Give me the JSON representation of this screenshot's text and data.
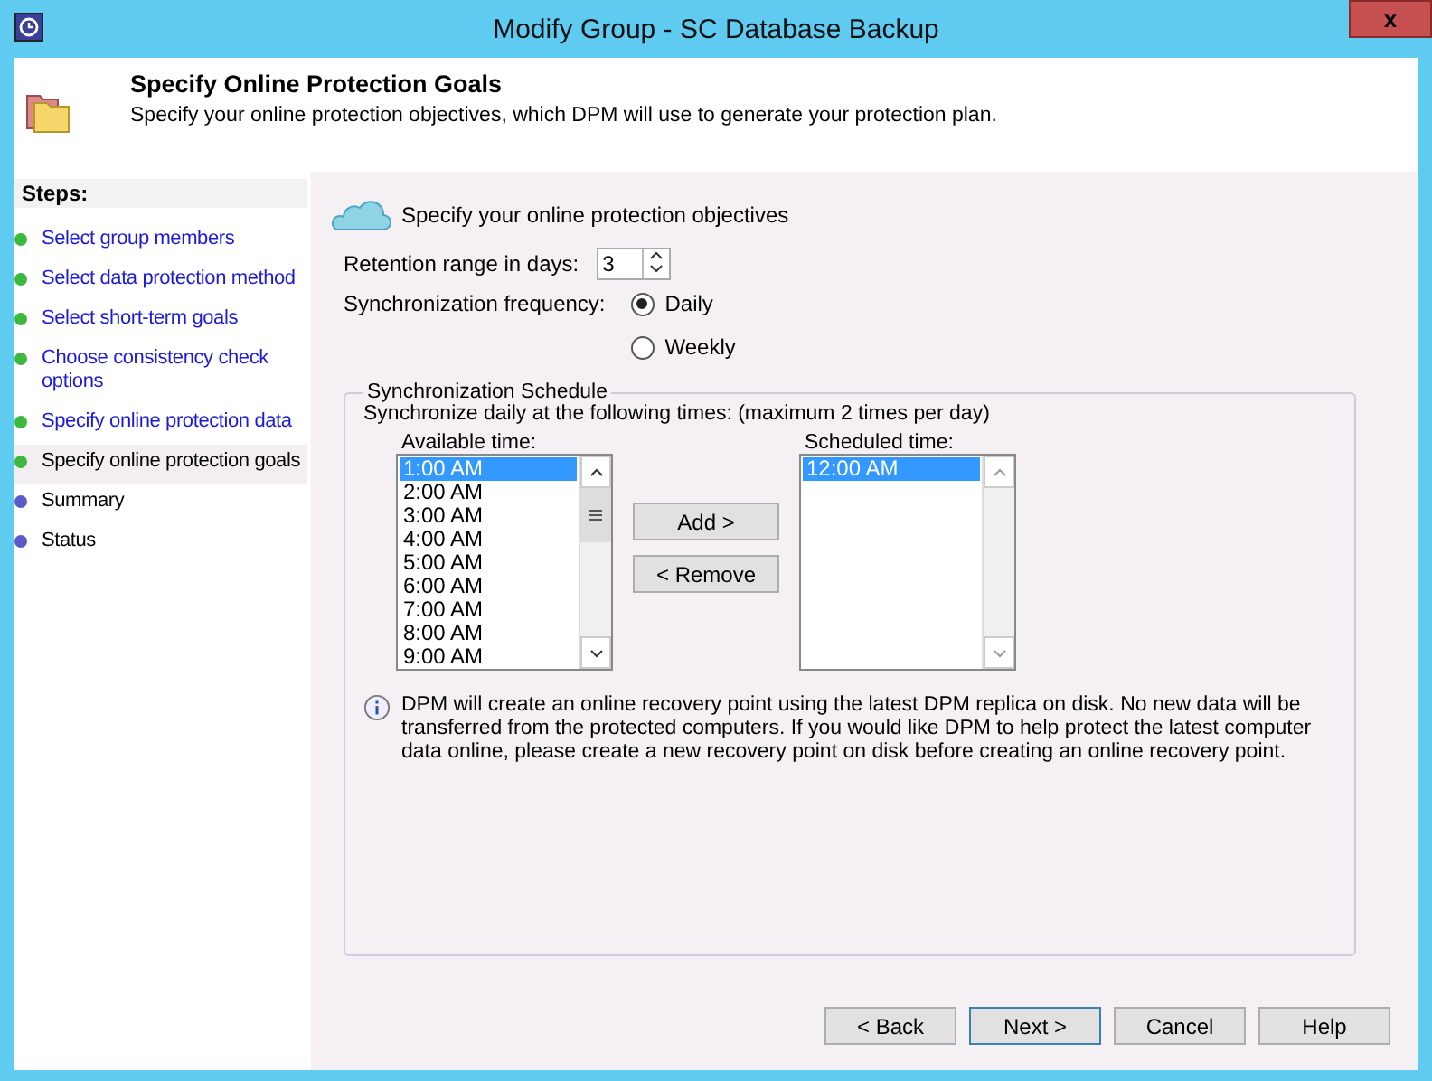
{
  "window": {
    "title": "Modify Group - SC Database Backup",
    "close": "x"
  },
  "header": {
    "title": "Specify Online Protection Goals",
    "subtitle": "Specify your online protection objectives, which DPM will use to generate your protection plan."
  },
  "sidebar": {
    "title": "Steps:",
    "items": [
      {
        "label": "Select group members",
        "kind": "link",
        "color": "#3cb93c",
        "selected": false
      },
      {
        "label": "Select data protection method",
        "kind": "link",
        "color": "#3cb93c",
        "selected": false
      },
      {
        "label": "Select short-term goals",
        "kind": "link",
        "color": "#3cb93c",
        "selected": false
      },
      {
        "label": "Choose consistency check options",
        "kind": "link",
        "color": "#3cb93c",
        "selected": false
      },
      {
        "label": "Specify online protection data",
        "kind": "link",
        "color": "#3cb93c",
        "selected": false
      },
      {
        "label": "Specify online protection goals",
        "kind": "plain",
        "color": "#3cb93c",
        "selected": true
      },
      {
        "label": "Summary",
        "kind": "plain",
        "color": "#5a5ac8",
        "selected": false
      },
      {
        "label": "Status",
        "kind": "plain",
        "color": "#5a5ac8",
        "selected": false
      }
    ]
  },
  "main": {
    "heading": "Specify your online protection objectives",
    "retention": {
      "label": "Retention range in days:",
      "value": "3"
    },
    "frequency": {
      "label": "Synchronization frequency:",
      "options": [
        {
          "label": "Daily",
          "selected": true
        },
        {
          "label": "Weekly",
          "selected": false
        }
      ]
    },
    "schedule": {
      "title": "Synchronization Schedule",
      "description": "Synchronize daily at the following times: (maximum 2 times per day)",
      "available": {
        "label": "Available time:",
        "items": [
          {
            "label": "1:00 AM",
            "selected": true
          },
          {
            "label": "2:00 AM",
            "selected": false
          },
          {
            "label": "3:00 AM",
            "selected": false
          },
          {
            "label": "4:00 AM",
            "selected": false
          },
          {
            "label": "5:00 AM",
            "selected": false
          },
          {
            "label": "6:00 AM",
            "selected": false
          },
          {
            "label": "7:00 AM",
            "selected": false
          },
          {
            "label": "8:00 AM",
            "selected": false
          },
          {
            "label": "9:00 AM",
            "selected": false
          }
        ]
      },
      "add": "Add >",
      "remove": "< Remove",
      "scheduled": {
        "label": "Scheduled time:",
        "items": [
          {
            "label": "12:00 AM",
            "selected": true
          }
        ]
      },
      "info": "DPM will create an online recovery point using the latest DPM replica on disk. No new data will be transferred from the protected computers. If you would like DPM to help protect the latest computer data online, please create a new recovery point on disk before creating an online recovery point."
    }
  },
  "buttons": [
    {
      "label": "< Back"
    },
    {
      "label": "Next >"
    },
    {
      "label": "Cancel"
    },
    {
      "label": "Help"
    }
  ]
}
